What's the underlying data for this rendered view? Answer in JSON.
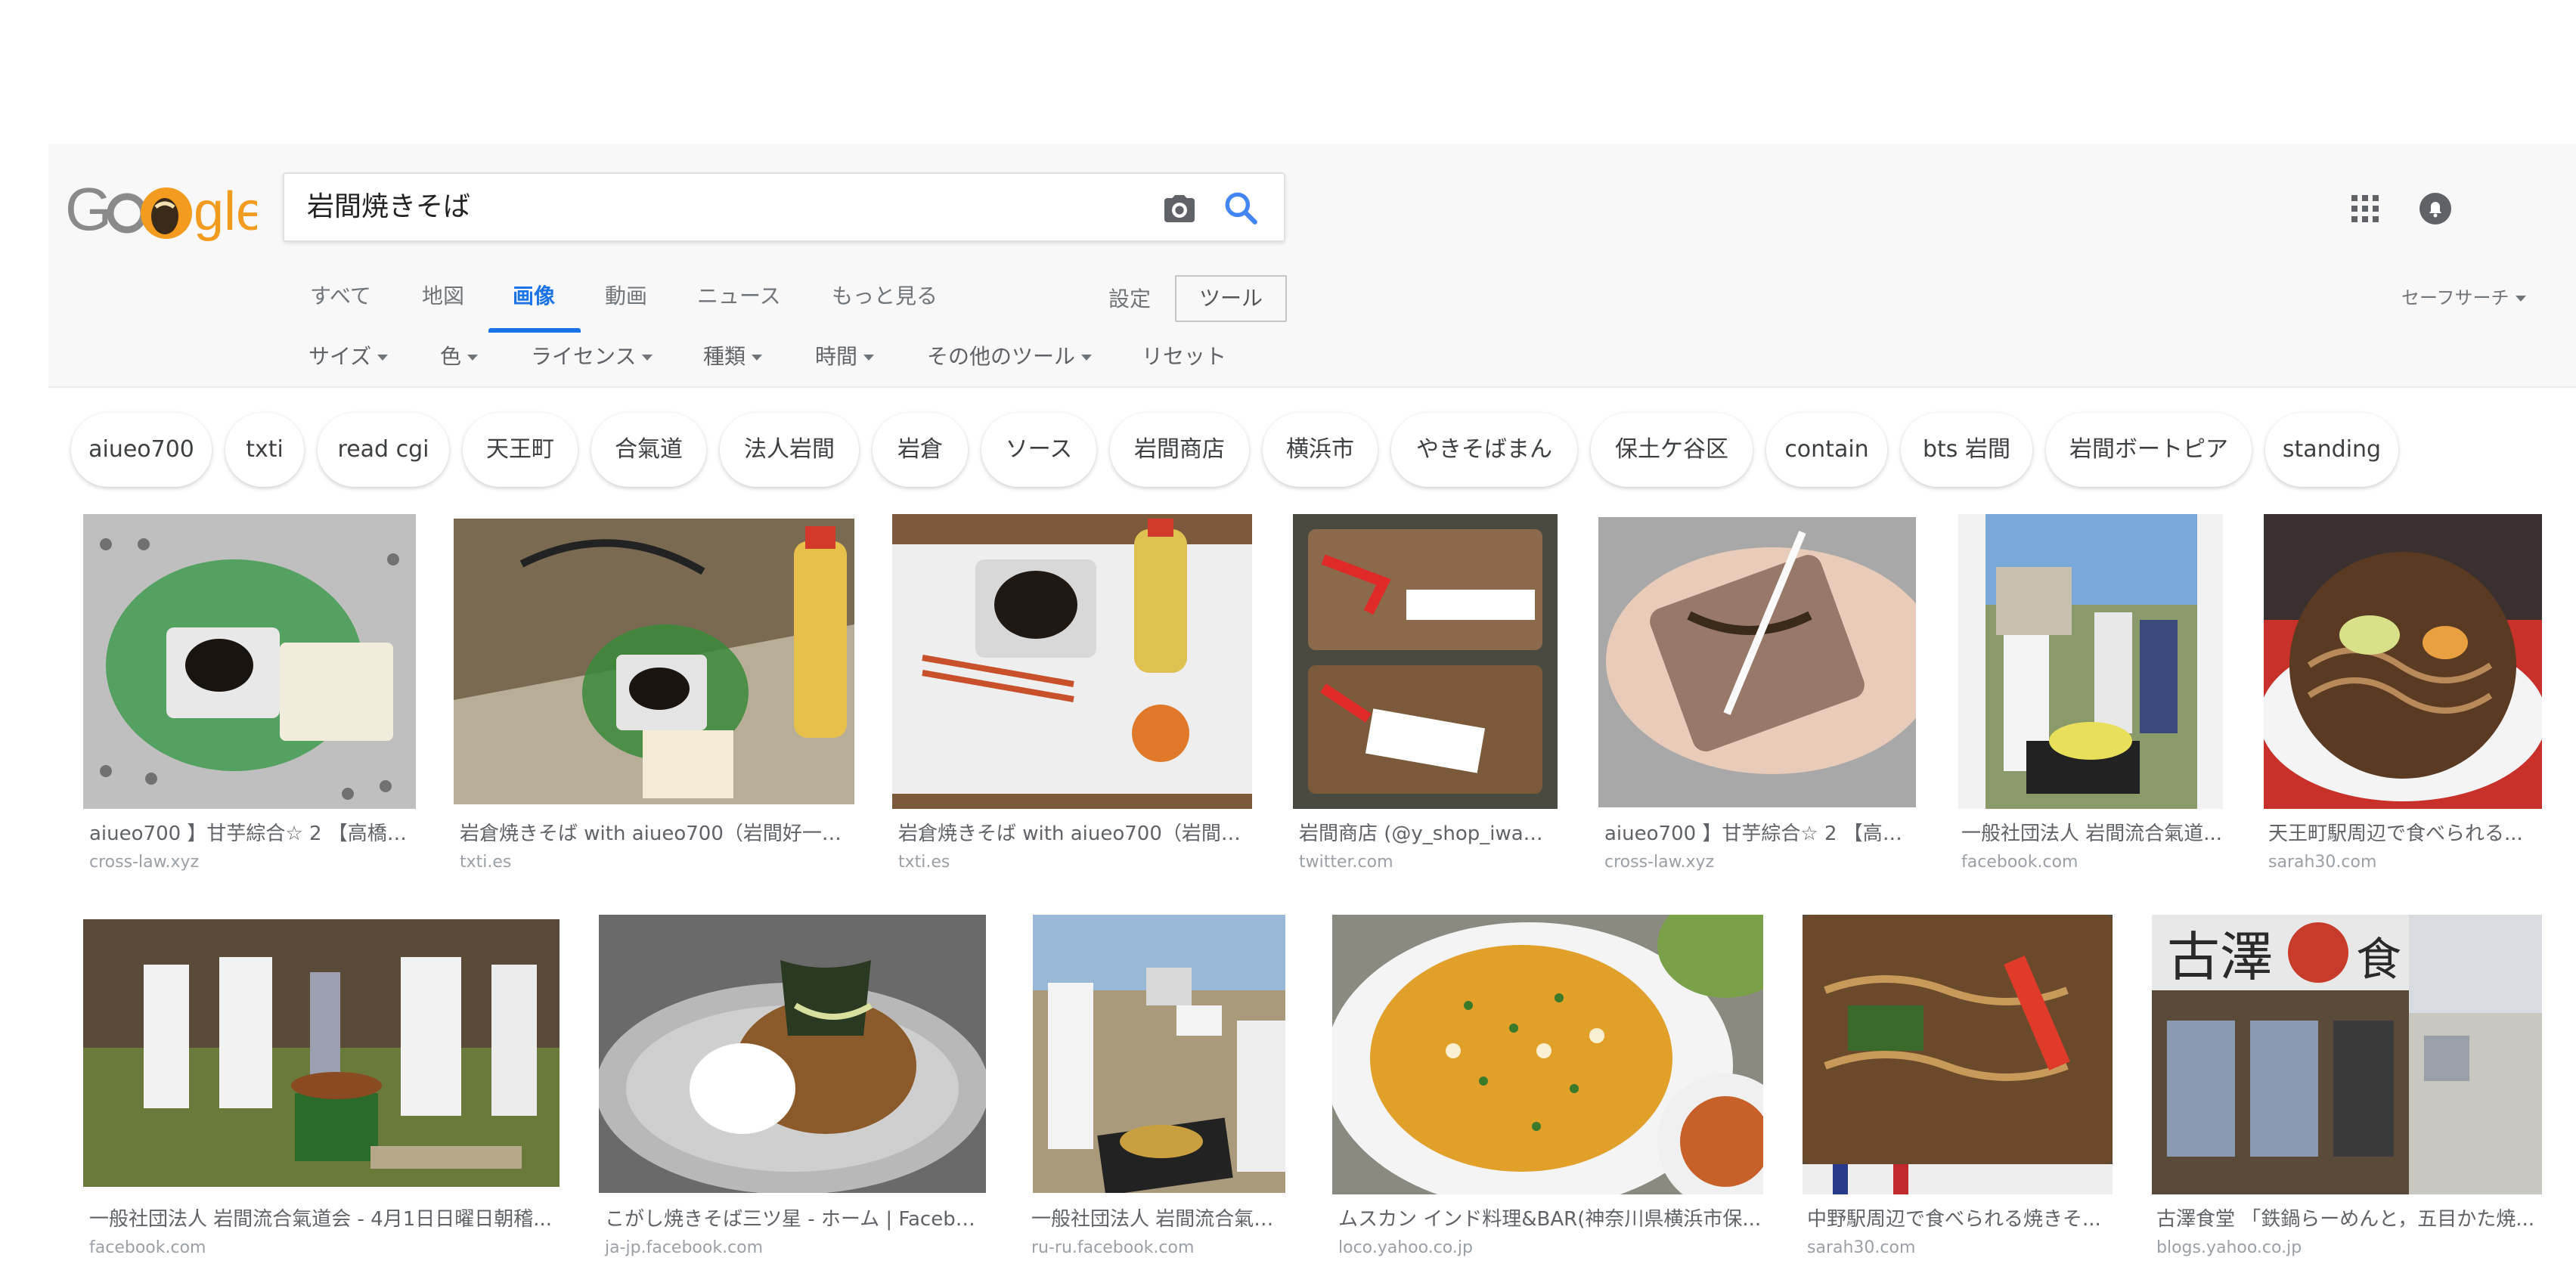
{
  "search": {
    "query": "岩間焼きそば"
  },
  "logo": {
    "text": "Google"
  },
  "tabs": [
    {
      "label": "すべて"
    },
    {
      "label": "地図"
    },
    {
      "label": "画像"
    },
    {
      "label": "動画"
    },
    {
      "label": "ニュース"
    },
    {
      "label": "もっと見る"
    }
  ],
  "settings_label": "設定",
  "tools_label": "ツール",
  "safesearch_label": "セーフサーチ",
  "filters": [
    {
      "label": "サイズ"
    },
    {
      "label": "色"
    },
    {
      "label": "ライセンス"
    },
    {
      "label": "種類"
    },
    {
      "label": "時間"
    },
    {
      "label": "その他のツール"
    },
    {
      "label": "リセット"
    }
  ],
  "chips": [
    "aiueo700",
    "txti",
    "read cgi",
    "天王町",
    "合氣道",
    "法人岩間",
    "岩倉",
    "ソース",
    "岩間商店",
    "横浜市",
    "やきそばまん",
    "保土ケ谷区",
    "contain",
    "bts 岩間",
    "岩間ボートピア",
    "standing"
  ],
  "results": [
    {
      "title": "aiueo700 】甘芋綜合☆ 2 【高橋嘉...",
      "source": "cross-law.xyz",
      "icon": "photo-food-tray-mat"
    },
    {
      "title": "岩倉焼きそば with aiueo700（岩間好一）...",
      "source": "txti.es",
      "icon": "photo-food-tray-bottle"
    },
    {
      "title": "岩倉焼きそば with aiueo700（岩間好...",
      "source": "txti.es",
      "icon": "photo-tray-chopsticks"
    },
    {
      "title": "岩間商店 (@y_shop_iwam...",
      "source": "twitter.com",
      "icon": "photo-yakisoba-packs"
    },
    {
      "title": "aiueo700 】甘芋綜合☆ 2 【高橋...",
      "source": "cross-law.xyz",
      "icon": "photo-yakisoba-hand"
    },
    {
      "title": "一般社団法人 岩間流合氣道...",
      "source": "facebook.com",
      "icon": "photo-outdoor-cooking"
    },
    {
      "title": "天王町駅周辺で食べられる...",
      "source": "sarah30.com",
      "icon": "photo-yakisoba-plate"
    },
    {
      "title": "一般社団法人 岩間流合氣道会 - 4月1日日曜日朝稽...",
      "source": "facebook.com",
      "icon": "photo-aikido-group"
    },
    {
      "title": "こがし焼きそば三ツ星 - ホーム | Facebook",
      "source": "ja-jp.facebook.com",
      "icon": "photo-yakisoba-platter"
    },
    {
      "title": "一般社団法人 岩間流合氣道...",
      "source": "ru-ru.facebook.com",
      "icon": "photo-outdoor-grill"
    },
    {
      "title": "ムスカン インド料理&BAR(神奈川県横浜市保...",
      "source": "loco.yahoo.co.jp",
      "icon": "photo-biryani"
    },
    {
      "title": "中野駅周辺で食べられる焼きそ...",
      "source": "sarah30.com",
      "icon": "photo-yakisoba-pack"
    },
    {
      "title": "古澤食堂 「鉄鍋らーめんと，五目かた焼...",
      "source": "blogs.yahoo.co.jp",
      "icon": "photo-restaurant-front"
    }
  ],
  "colors": {
    "accent": "#1a73e8",
    "band": "#f8f8f8",
    "logo_orange": "#f29b1e"
  }
}
